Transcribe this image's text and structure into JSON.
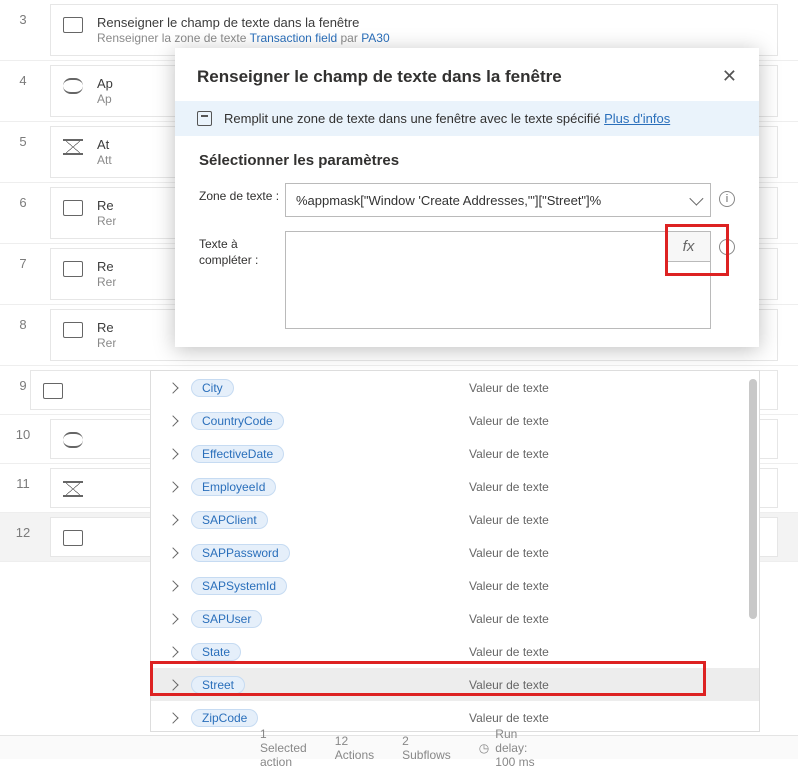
{
  "flow": {
    "rows": [
      {
        "n": "3",
        "icon": "box",
        "title": "Renseigner le champ de texte dans la fenêtre",
        "sub_pre": "Renseigner la zone de texte ",
        "link1": "Transaction field",
        "mid": " par ",
        "link2": "PA30"
      },
      {
        "n": "4",
        "icon": "loop",
        "title": "Ap",
        "sub": "Ap"
      },
      {
        "n": "5",
        "icon": "hourglass",
        "title": "At",
        "sub": "Att"
      },
      {
        "n": "6",
        "icon": "box",
        "title": "Re",
        "sub": "Rer"
      },
      {
        "n": "7",
        "icon": "box",
        "title": "Re",
        "sub": "Rer"
      },
      {
        "n": "8",
        "icon": "box",
        "title": "Re",
        "sub": "Rer"
      },
      {
        "n": "9",
        "icon": "box",
        "title": "",
        "sub": ""
      },
      {
        "n": "10",
        "icon": "loop",
        "title": "",
        "sub": ""
      },
      {
        "n": "11",
        "icon": "hourglass",
        "title": "",
        "sub": ""
      },
      {
        "n": "12",
        "icon": "box",
        "title": "",
        "sub": ""
      }
    ]
  },
  "dialog": {
    "title": "Renseigner le champ de texte dans la fenêtre",
    "info_text": "Remplit une zone de texte dans une fenêtre avec le texte spécifié ",
    "info_link": "Plus d'infos",
    "section": "Sélectionner les paramètres",
    "param_zone_label": "Zone de texte :",
    "param_zone_value": "%appmask[\"Window 'Create Addresses,'\"][\"Street\"]%",
    "param_text_label": "Texte à compléter :",
    "fx": "fx"
  },
  "variables": {
    "type_label": "Valeur de texte",
    "items": [
      "City",
      "CountryCode",
      "EffectiveDate",
      "EmployeeId",
      "SAPClient",
      "SAPPassword",
      "SAPSystemId",
      "SAPUser",
      "State",
      "Street",
      "ZipCode"
    ]
  },
  "status": {
    "selected": "1 Selected action",
    "actions": "12 Actions",
    "subflows": "2 Subflows",
    "delay": "Run delay: 100 ms"
  }
}
